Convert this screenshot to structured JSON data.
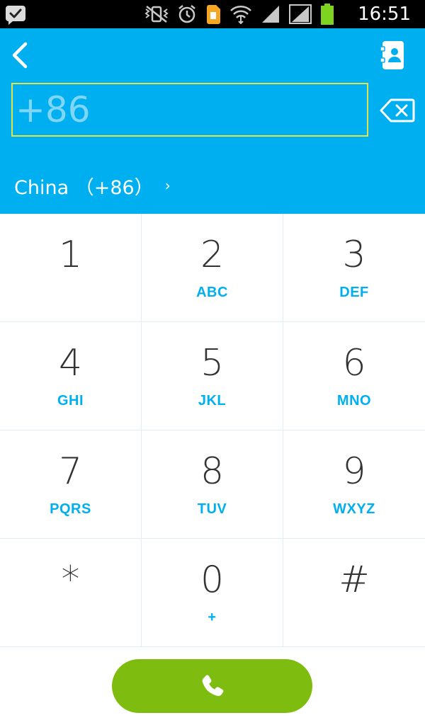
{
  "status_bar": {
    "time": "16:51",
    "icons": [
      "checkmark-bubble-icon",
      "vibrate-icon",
      "alarm-icon",
      "sim-card-icon",
      "wifi-icon",
      "signal-icon",
      "signal-icon",
      "battery-icon"
    ]
  },
  "header": {
    "phone_placeholder": "+86",
    "country_label": "China （+86）",
    "country_chevron": "›",
    "accent_color": "#00aff0",
    "input_border_color": "#e2e54a"
  },
  "keypad": {
    "keys": [
      {
        "digit": "1",
        "letters": ""
      },
      {
        "digit": "2",
        "letters": "ABC"
      },
      {
        "digit": "3",
        "letters": "DEF"
      },
      {
        "digit": "4",
        "letters": "GHI"
      },
      {
        "digit": "5",
        "letters": "JKL"
      },
      {
        "digit": "6",
        "letters": "MNO"
      },
      {
        "digit": "7",
        "letters": "PQRS"
      },
      {
        "digit": "8",
        "letters": "TUV"
      },
      {
        "digit": "9",
        "letters": "WXYZ"
      },
      {
        "digit": "*",
        "letters": ""
      },
      {
        "digit": "0",
        "letters": "+"
      },
      {
        "digit": "#",
        "letters": ""
      }
    ]
  },
  "call_button": {
    "icon": "phone-icon",
    "color": "#7ebd10"
  }
}
